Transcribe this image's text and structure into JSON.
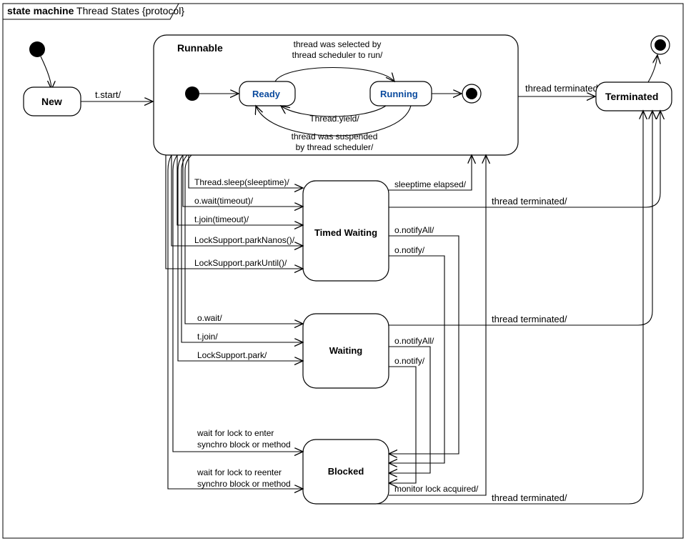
{
  "frame_title_prefix": "state machine",
  "frame_title": "Thread States {protocol}",
  "states": {
    "new": "New",
    "runnable": "Runnable",
    "ready": "Ready",
    "running": "Running",
    "timed_waiting": "Timed Waiting",
    "waiting": "Waiting",
    "blocked": "Blocked",
    "terminated": "Terminated"
  },
  "runnable_internal": {
    "to_running_1": "thread was selected by",
    "to_running_2": "thread scheduler to run/",
    "yield": "Thread.yield/",
    "suspended_1": "thread was suspended",
    "suspended_2": "by thread scheduler/"
  },
  "trans": {
    "t_start": "t.start/",
    "term": "thread terminated/",
    "tw": {
      "t0": "Thread.sleep(sleeptime)/",
      "t1": "o.wait(timeout)/",
      "t2": "t.join(timeout)/",
      "t3": "LockSupport.parkNanos()/",
      "t4": "LockSupport.parkUntil()/"
    },
    "tw_back": {
      "b0": "sleeptime elapsed/",
      "b1": "o.notifyAll/",
      "b2": "o.notify/"
    },
    "w": {
      "t0": "o.wait/",
      "t1": "t.join/",
      "t2": "LockSupport.park/"
    },
    "w_back": {
      "b0": "o.notifyAll/",
      "b1": "o.notify/"
    },
    "blk": {
      "t0a": "wait for lock to enter",
      "t0b": "synchro block or method",
      "t1a": "wait for lock to reenter",
      "t1b": "synchro block or method"
    },
    "blk_back": "monitor lock acquired/"
  }
}
